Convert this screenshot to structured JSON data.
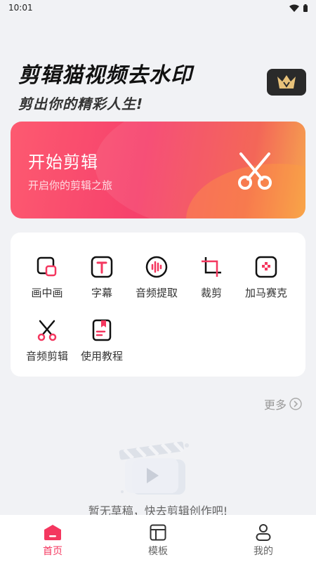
{
  "status_bar": {
    "time": "10:01"
  },
  "header": {
    "title": "剪辑猫视频去水印",
    "subtitle": "剪出你的精彩人生!"
  },
  "hero": {
    "title": "开始剪辑",
    "subtitle": "开启你的剪辑之旅"
  },
  "tools": [
    {
      "label": "画中画",
      "icon": "picture-in-picture-icon"
    },
    {
      "label": "字幕",
      "icon": "text-icon"
    },
    {
      "label": "音频提取",
      "icon": "audio-extract-icon"
    },
    {
      "label": "裁剪",
      "icon": "crop-icon"
    },
    {
      "label": "加马赛克",
      "icon": "mosaic-icon"
    },
    {
      "label": "音频剪辑",
      "icon": "scissors-icon"
    },
    {
      "label": "使用教程",
      "icon": "tutorial-icon"
    }
  ],
  "more": {
    "label": "更多"
  },
  "empty_state": {
    "text": "暂无草稿，快去剪辑创作吧!"
  },
  "bottom_nav": [
    {
      "label": "首页",
      "icon": "home-icon",
      "active": true
    },
    {
      "label": "模板",
      "icon": "template-icon",
      "active": false
    },
    {
      "label": "我的",
      "icon": "profile-icon",
      "active": false
    }
  ],
  "colors": {
    "accent": "#f4375f",
    "hero_gradient_start": "#fd5a70",
    "hero_gradient_end": "#f6a040",
    "vip_background": "#2a2a2a",
    "vip_gold": "#e8c27a"
  }
}
